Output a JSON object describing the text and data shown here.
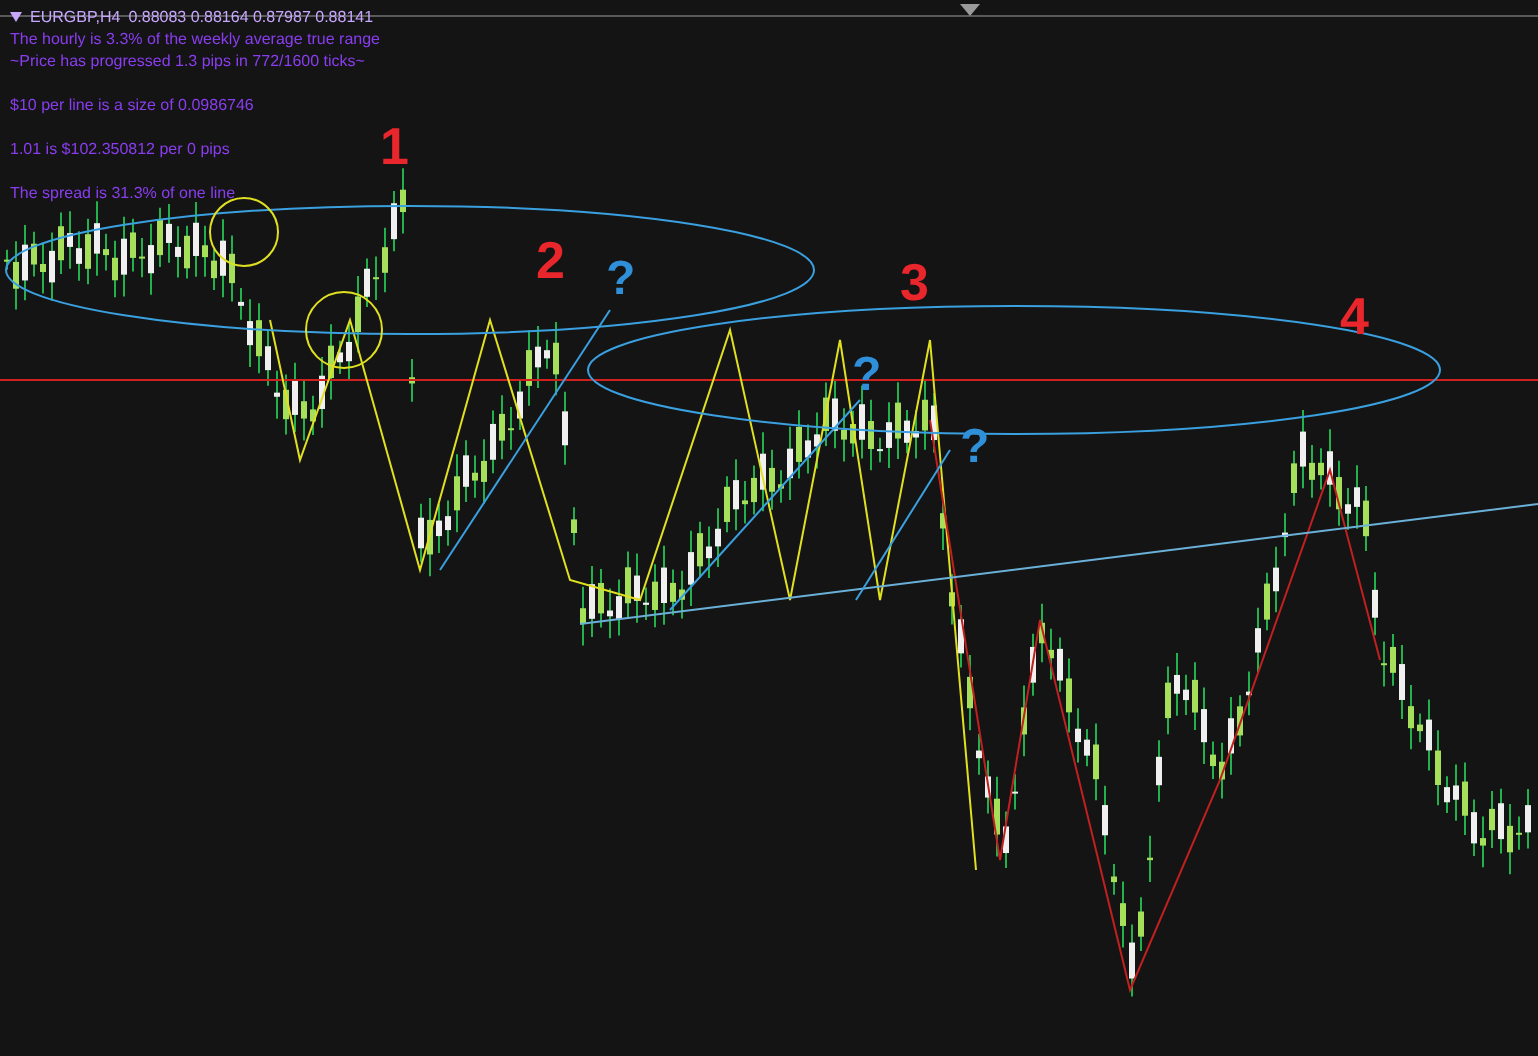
{
  "header": {
    "symbol": "EURGBP,H4",
    "ohlc": "0.88083 0.88164 0.87987 0.88141"
  },
  "info_lines": [
    "The hourly is 3.3% of the weekly average true range",
    "~Price has progressed  1.3  pips in 772/1600 ticks~",
    "$10 per line is a size of 0.0986746",
    "1.01 is $102.350812 per 0 pips",
    "The spread is 31.3% of one line"
  ],
  "annotations": [
    {
      "text": "1",
      "kind": "number",
      "color": "#e8262b"
    },
    {
      "text": "2",
      "kind": "number",
      "color": "#e8262b"
    },
    {
      "text": "?",
      "kind": "question",
      "color": "#2f8fd8"
    },
    {
      "text": "3",
      "kind": "number",
      "color": "#e8262b"
    },
    {
      "text": "?",
      "kind": "question",
      "color": "#2f8fd8"
    },
    {
      "text": "?",
      "kind": "question",
      "color": "#2f8fd8"
    },
    {
      "text": "4",
      "kind": "number",
      "color": "#e8262b"
    }
  ]
}
